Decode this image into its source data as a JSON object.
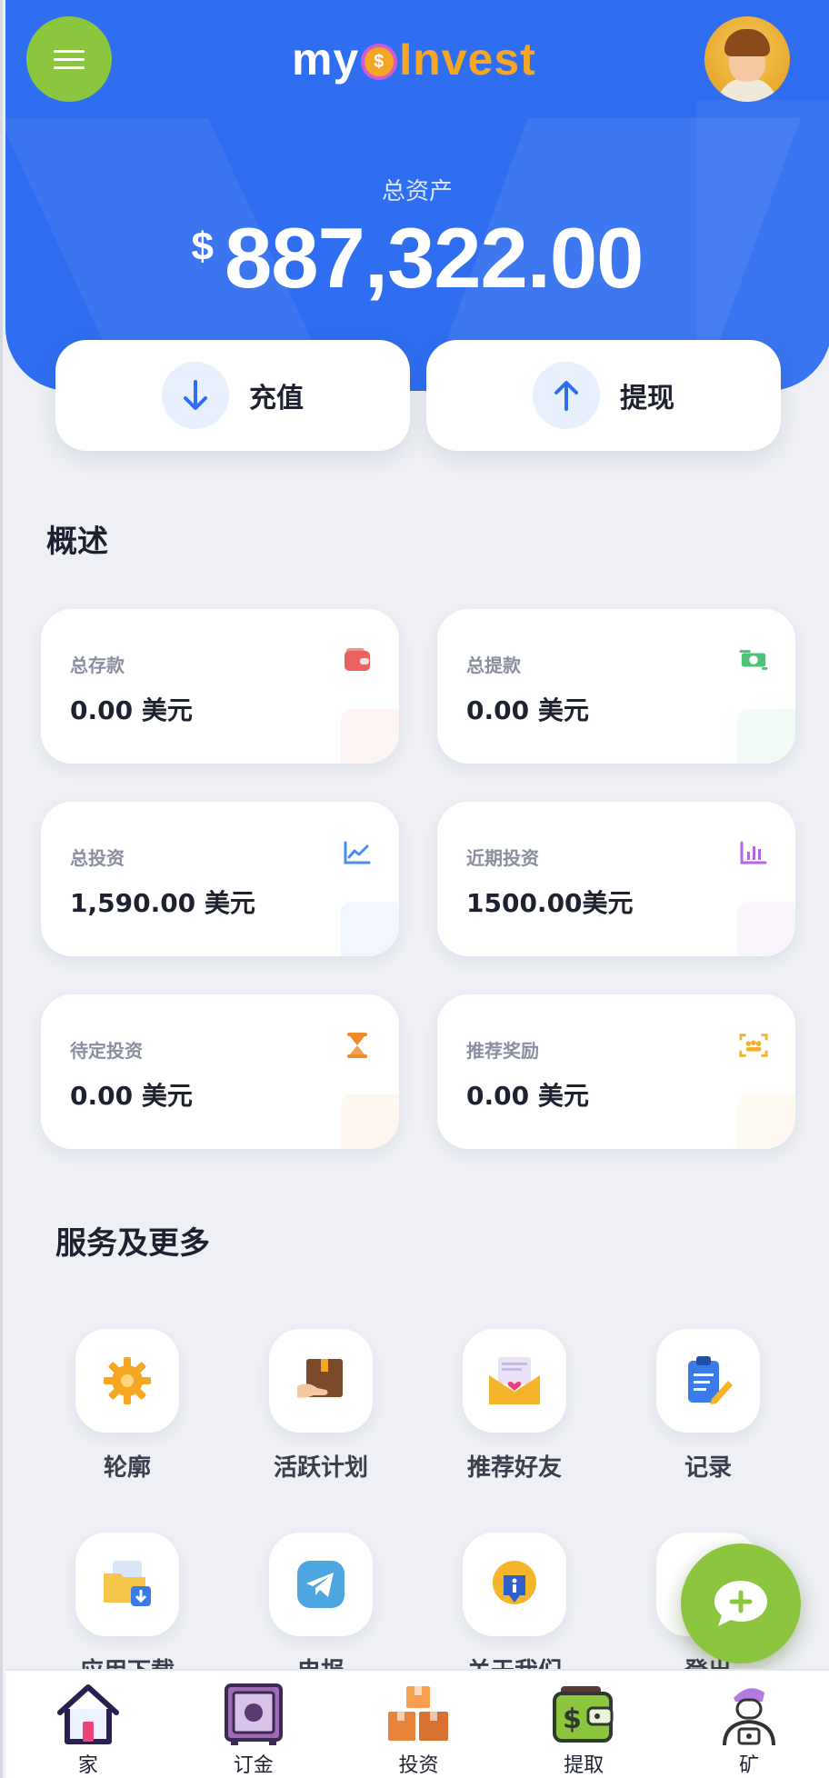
{
  "header": {
    "logo_prefix": "my",
    "logo_suffix": "Invest",
    "total_label": "总资产",
    "currency_symbol": "$",
    "total_amount": "887,322.00"
  },
  "actions": {
    "deposit_label": "充值",
    "withdraw_label": "提现"
  },
  "overview": {
    "title": "概述",
    "cards": [
      {
        "label": "总存款",
        "value": "0.00 美元",
        "icon": "wallet-icon",
        "color": "#e8625f"
      },
      {
        "label": "总提款",
        "value": "0.00 美元",
        "icon": "cash-exchange-icon",
        "color": "#4cc27a"
      },
      {
        "label": "总投资",
        "value": "1,590.00 美元",
        "icon": "line-chart-icon",
        "color": "#4a8cf0"
      },
      {
        "label": "近期投资",
        "value": "1500.00美元",
        "icon": "bar-chart-icon",
        "color": "#b565e8"
      },
      {
        "label": "待定投资",
        "value": "0.00 美元",
        "icon": "hourglass-icon",
        "color": "#ef8a2a"
      },
      {
        "label": "推荐奖励",
        "value": "0.00 美元",
        "icon": "team-scan-icon",
        "color": "#f2b233"
      }
    ]
  },
  "services": {
    "title": "服务及更多",
    "items": [
      {
        "label": "轮廓",
        "icon": "gear-icon"
      },
      {
        "label": "活跃计划",
        "icon": "package-hand-icon"
      },
      {
        "label": "推荐好友",
        "icon": "envelope-heart-icon"
      },
      {
        "label": "记录",
        "icon": "clipboard-pen-icon"
      },
      {
        "label": "应用下载",
        "icon": "folder-download-icon"
      },
      {
        "label": "电报",
        "icon": "telegram-icon"
      },
      {
        "label": "关于我们",
        "icon": "info-badge-icon"
      },
      {
        "label": "登出",
        "icon": "logout-icon"
      }
    ]
  },
  "bottom_nav": [
    {
      "label": "家",
      "icon": "home-icon"
    },
    {
      "label": "订金",
      "icon": "safe-icon"
    },
    {
      "label": "投资",
      "icon": "boxes-icon"
    },
    {
      "label": "提取",
      "icon": "wallet-cash-icon"
    },
    {
      "label": "矿",
      "icon": "miner-icon"
    }
  ],
  "colors": {
    "header_blue": "#2f6ef0",
    "accent_green": "#8cc63f",
    "logo_orange": "#f5a623"
  }
}
